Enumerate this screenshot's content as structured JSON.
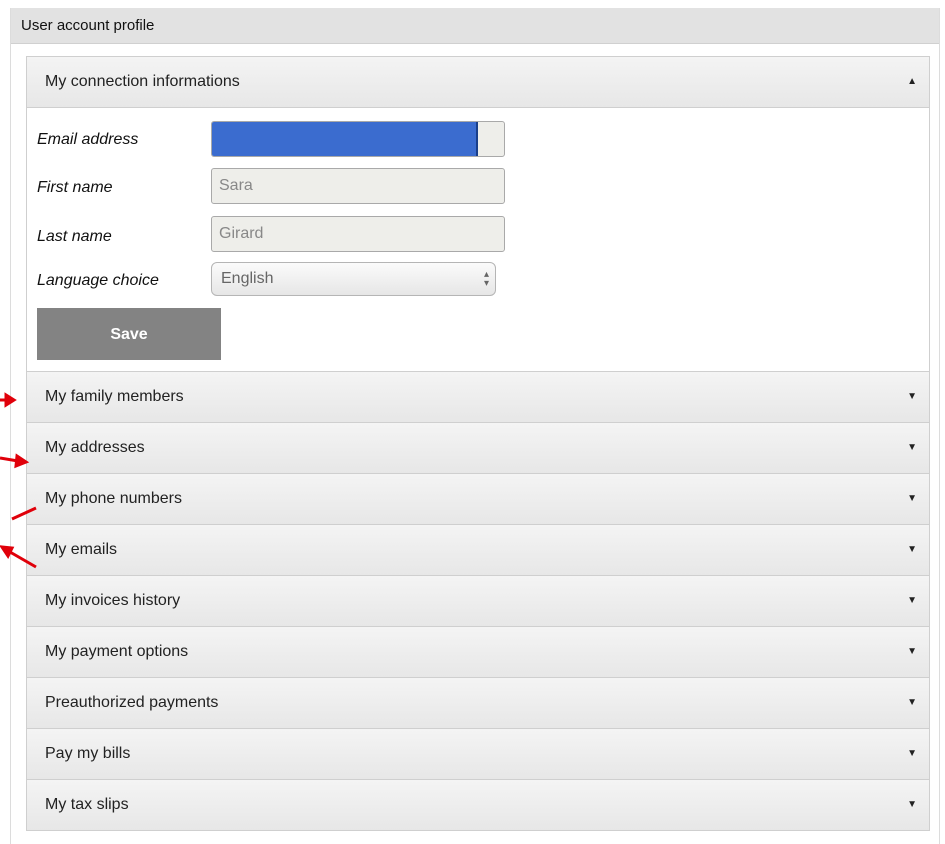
{
  "panel": {
    "title": "User account profile"
  },
  "connection": {
    "header": "My connection informations",
    "caret": "▲",
    "fields": {
      "email_label": "Email address",
      "first_name_label": "First name",
      "first_name_value": "Sara",
      "last_name_label": "Last name",
      "last_name_value": "Girard",
      "language_label": "Language choice",
      "language_value": "English"
    },
    "save_label": "Save"
  },
  "sections": [
    {
      "label": "My family members",
      "caret": "▼"
    },
    {
      "label": "My addresses",
      "caret": "▼"
    },
    {
      "label": "My phone numbers",
      "caret": "▼"
    },
    {
      "label": "My emails",
      "caret": "▼"
    },
    {
      "label": "My invoices history",
      "caret": "▼"
    },
    {
      "label": "My payment options",
      "caret": "▼"
    },
    {
      "label": "Preauthorized payments",
      "caret": "▼"
    },
    {
      "label": "Pay my bills",
      "caret": "▼"
    },
    {
      "label": "My tax slips",
      "caret": "▼"
    }
  ],
  "colors": {
    "annotation_arrow": "#e0000a",
    "email_highlight": "#3b6ccf",
    "save_button": "#838383"
  }
}
